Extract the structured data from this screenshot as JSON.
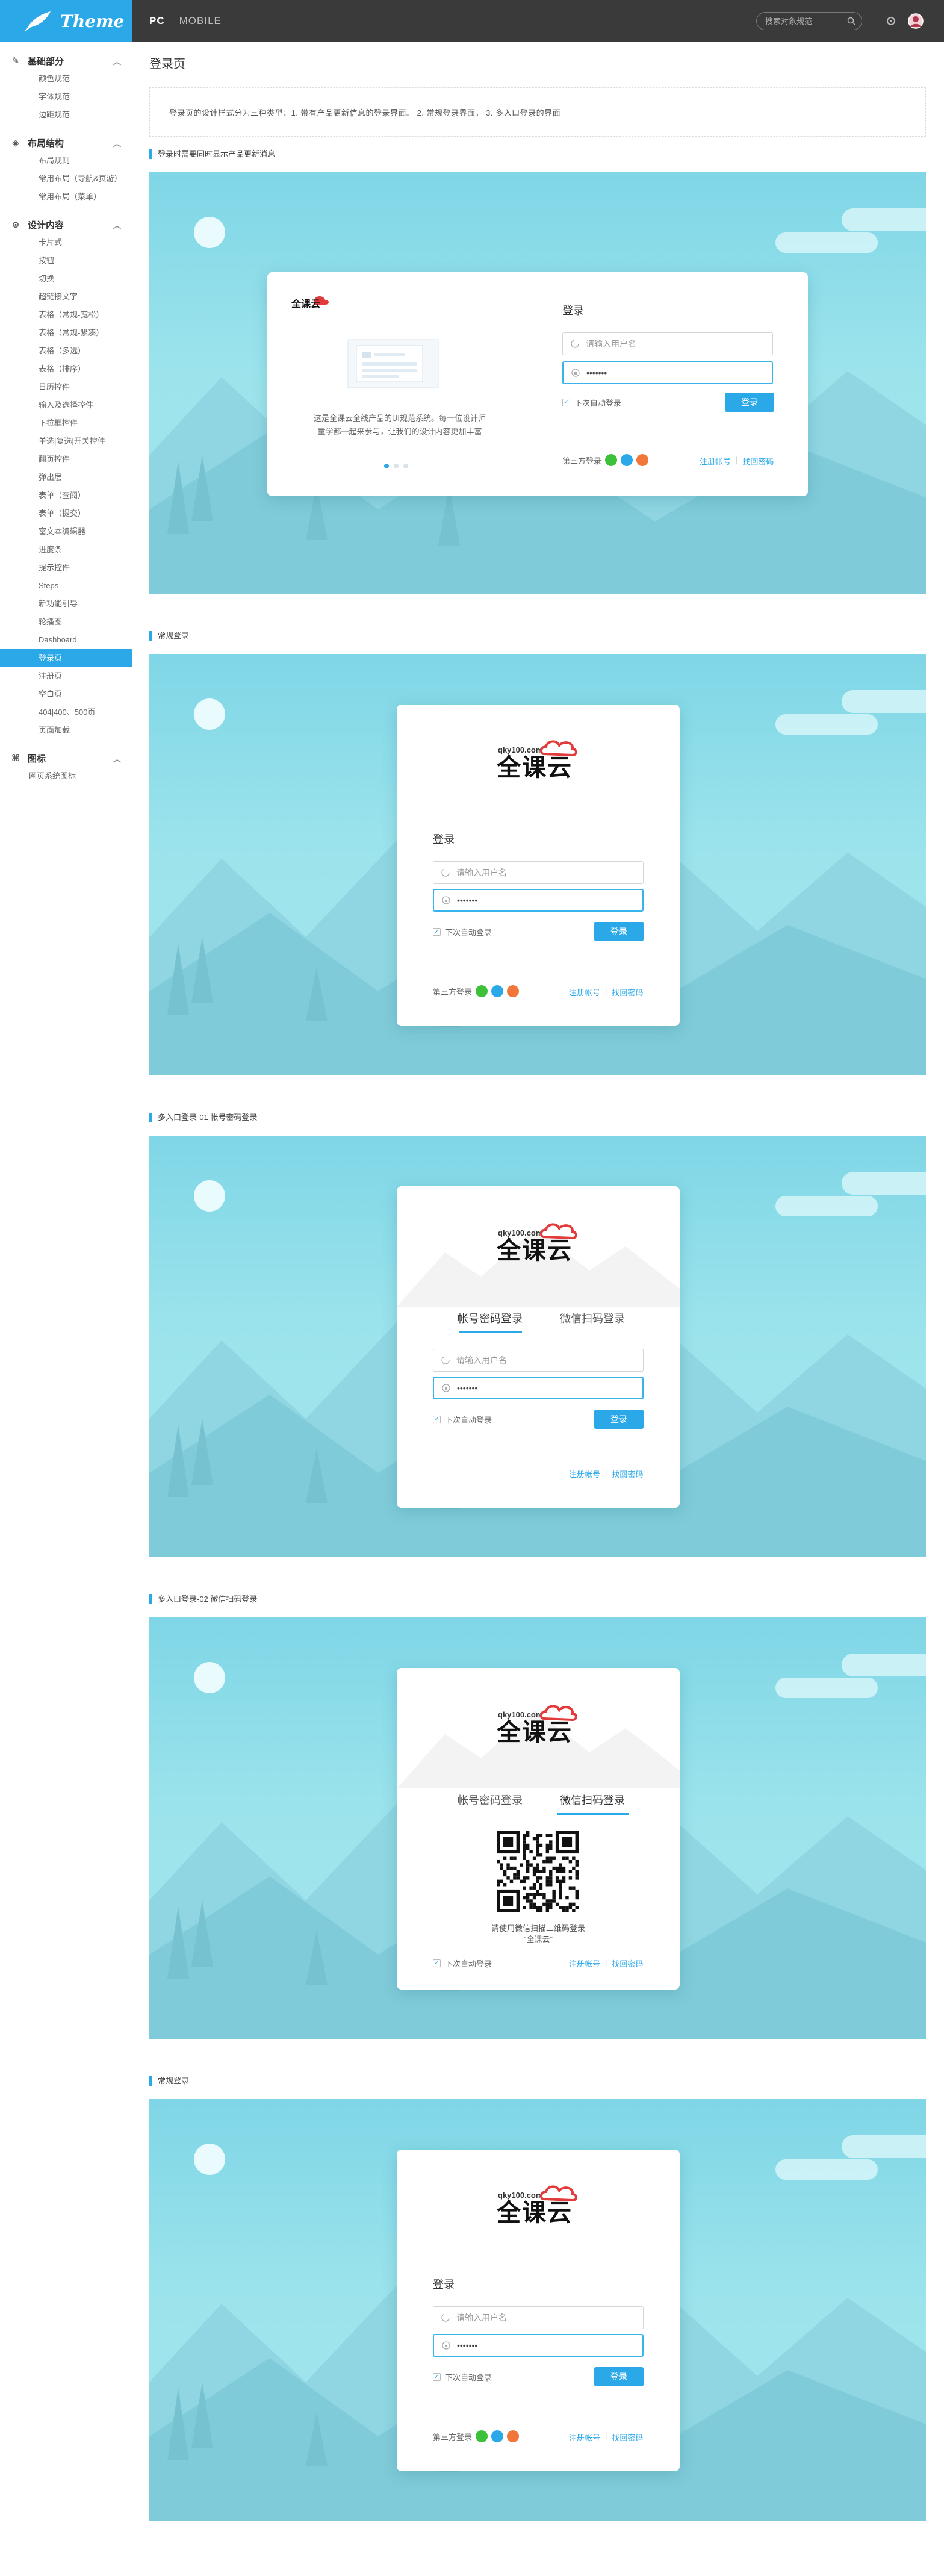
{
  "topbar": {
    "logo_text": "Theme",
    "tabs": [
      "PC",
      "MOBILE"
    ],
    "search_placeholder": "搜索对象规范"
  },
  "sidebar": {
    "groups": [
      {
        "label": "基础部分",
        "icon": "pen-icon",
        "items": [
          "颜色规范",
          "字体规范",
          "边距规范"
        ]
      },
      {
        "label": "布局结构",
        "icon": "layers-icon",
        "items": [
          "布局规则",
          "常用布局（导航&页游）",
          "常用布局（菜单）"
        ]
      },
      {
        "label": "设计内容",
        "icon": "toggle-icon",
        "items": [
          "卡片式",
          "按钮",
          "切换",
          "超链接文字",
          "表格（常规-宽松）",
          "表格（常规-紧凑）",
          "表格（多选）",
          "表格（排序）",
          "日历控件",
          "输入及选择控件",
          "下拉框控件",
          "单选|复选|开关控件",
          "翻页控件",
          "弹出层",
          "表单（查阅）",
          "表单（提交）",
          "富文本编辑器",
          "进度条",
          "提示控件",
          "Steps",
          "新功能引导",
          "轮播图",
          "Dashboard",
          "登录页",
          "注册页",
          "空白页",
          "404|400、500页",
          "页面加载"
        ],
        "active": "登录页"
      },
      {
        "label": "图标",
        "icon": "command-icon",
        "items": [
          "网页系统图标"
        ]
      }
    ]
  },
  "main": {
    "title": "登录页",
    "description": "登录页的设计样式分为三种类型：1. 带有产品更新信息的登录界面。  2. 常规登录界面。  3. 多入口登录的界面",
    "sections": [
      "登录时需要同时显示产品更新消息",
      "常规登录",
      "多入口登录-01 帐号密码登录",
      "多入口登录-02 微信扫码登录",
      "常规登录"
    ]
  },
  "login": {
    "brand_domain": "qky100.com",
    "brand_name": "全课云",
    "title": "登录",
    "username_placeholder": "请输入用户名",
    "password_value": "•••••••",
    "remember": "下次自动登录",
    "submit": "登录",
    "third_party": "第三方登录",
    "register": "注册帐号",
    "forgot": "找回密码",
    "tab_account": "帐号密码登录",
    "tab_wechat": "微信扫码登录",
    "qr_hint_line1": "请使用微信扫描二维码登录",
    "qr_hint_line2": "“全课云”",
    "promo_line1": "这是全课云全线产品的UI规范系统。每一位设计师",
    "promo_line2": "童学都一起来参与，让我们的设计内容更加丰富"
  },
  "colors": {
    "accent": "#2aa8e8",
    "topbar": "#3a3a3a",
    "sky": "#9be3ec"
  }
}
